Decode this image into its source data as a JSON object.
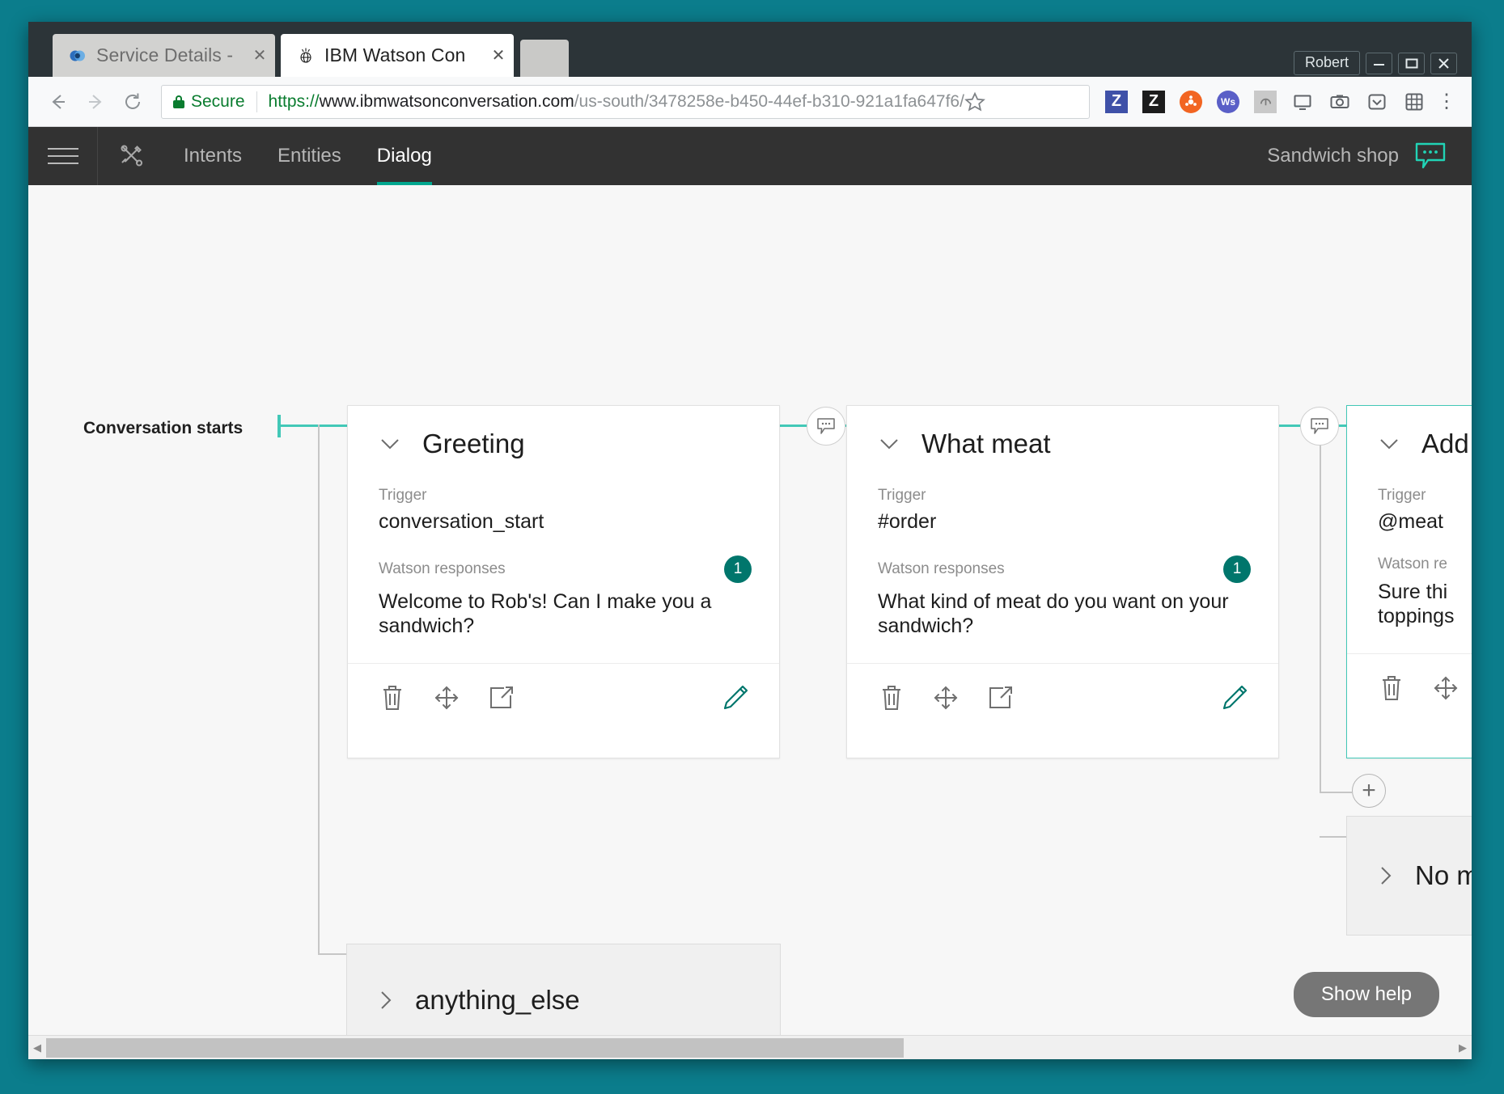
{
  "window": {
    "user_chip": "Robert",
    "minimize_label": "—",
    "maximize_label": "▢",
    "close_label": "✕"
  },
  "browser": {
    "tabs": [
      {
        "title": "Service Details -",
        "favicon": "bluemix-icon",
        "close": "✕",
        "active": false
      },
      {
        "title": "IBM Watson Con",
        "favicon": "watson-icon",
        "close": "✕",
        "active": true
      }
    ],
    "back_label": "←",
    "forward_label": "→",
    "reload_label": "⟳",
    "security_label": "Secure",
    "url": {
      "scheme": "https://",
      "host": "www.ibmwatsonconversation.com",
      "path": "/us-south/3478258e-b450-44ef-b310-921a1fa647f6/"
    },
    "bookmark_label": "☆",
    "menu_label": "⋮",
    "extensions": [
      {
        "name": "zotero-blue-extension",
        "glyph": "Z",
        "bg": "#3f51a8",
        "fg": "#ffffff"
      },
      {
        "name": "zotero-black-extension",
        "glyph": "Z",
        "bg": "#1c1c1c",
        "fg": "#ffffff"
      },
      {
        "name": "orange-circle-extension",
        "glyph": "",
        "bg": "#f26522",
        "fg": "#ffffff"
      },
      {
        "name": "websters-extension",
        "glyph": "Ws",
        "bg": "#5a5fc7",
        "fg": "#ffffff"
      },
      {
        "name": "dropbox-extension",
        "glyph": "",
        "bg": "#c9c9c9",
        "fg": "#7b7b7b"
      },
      {
        "name": "screen-extension",
        "glyph": "",
        "bg": "#f8f9fa",
        "fg": "#5f6368"
      },
      {
        "name": "camera-extension",
        "glyph": "",
        "bg": "#f8f9fa",
        "fg": "#5f6368"
      },
      {
        "name": "pocket-extension",
        "glyph": "",
        "bg": "#f8f9fa",
        "fg": "#5f6368"
      },
      {
        "name": "grid-extension",
        "glyph": "",
        "bg": "#f8f9fa",
        "fg": "#5f6368"
      }
    ]
  },
  "app": {
    "menu_label": "Menu",
    "tools_label": "Tools",
    "tabs": [
      {
        "label": "Intents",
        "active": false
      },
      {
        "label": "Entities",
        "active": false
      },
      {
        "label": "Dialog",
        "active": true
      }
    ],
    "workspace_name": "Sandwich shop",
    "chat_icon": "chat-bubble-icon",
    "accent_color": "#00a78f"
  },
  "canvas": {
    "start_label": "Conversation starts",
    "trigger_label": "Trigger",
    "responses_label": "Watson responses",
    "responses_label_truncated": "Watson re",
    "show_help_label": "Show help",
    "add_node_label": "+",
    "nodes": [
      {
        "name": "greeting",
        "title": "Greeting",
        "trigger": "conversation_start",
        "response": "Welcome to Rob's! Can I make you a sandwich?",
        "response_count": "1",
        "selected": false,
        "collapsed": false,
        "actions": [
          "delete-icon",
          "move-icon",
          "jump-to-icon",
          "edit-icon"
        ]
      },
      {
        "name": "what-meat",
        "title": "What meat",
        "trigger": "#order",
        "response": "What kind of meat do you want on your sandwich?",
        "response_count": "1",
        "selected": false,
        "collapsed": false,
        "actions": [
          "delete-icon",
          "move-icon",
          "jump-to-icon",
          "edit-icon"
        ]
      },
      {
        "name": "add-meat",
        "title": "Add m",
        "trigger": "@meat",
        "response_line1": "Sure thi",
        "response_line2": "toppings",
        "selected": true,
        "collapsed": false,
        "actions": [
          "delete-icon",
          "move-icon"
        ]
      }
    ],
    "collapsed_nodes": [
      {
        "name": "anything-else",
        "title": "anything_else"
      },
      {
        "name": "no-meat",
        "title": "No me"
      }
    ]
  },
  "scrollbar": {
    "left_arrow": "◀",
    "right_arrow": "▶"
  }
}
